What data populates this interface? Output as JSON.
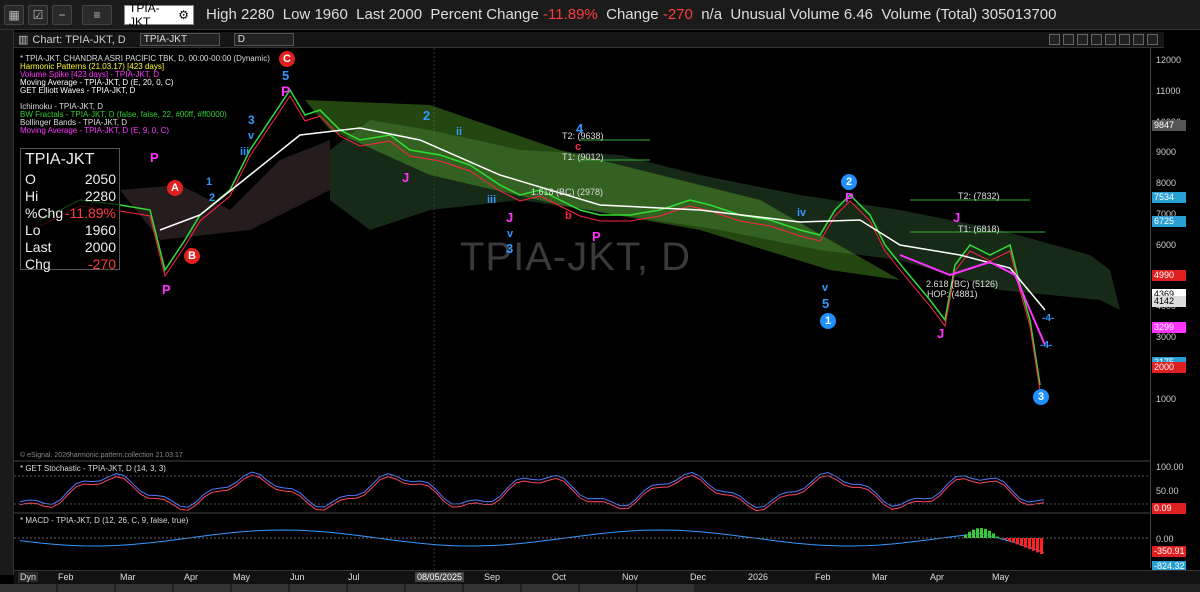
{
  "topbar": {
    "symbol": "TPIA-JKT",
    "high_label": "High",
    "high": "2280",
    "low_label": "Low",
    "low": "1960",
    "last_label": "Last",
    "last": "2000",
    "pct_label": "Percent Change",
    "pct": "-11.89%",
    "chg_label": "Change",
    "chg": "-270",
    "na": "n/a",
    "uv_label": "Unusual Volume",
    "uv": "6.46",
    "vol_label": "Volume (Total)",
    "vol": "305013700"
  },
  "chart_header": {
    "title": "Chart: TPIA-JKT, D",
    "symbol_input": "TPIA-JKT",
    "interval_input": "D"
  },
  "studies": [
    {
      "text": "* TPIA-JKT, CHANDRA ASRI PACIFIC TBK, D, 00:00-00:00 (Dynamic)",
      "color": "#dddddd"
    },
    {
      "text": "Harmonic Patterns (21.03.17) [423 days]",
      "color": "#ffff33"
    },
    {
      "text": "Volume Spike [423 days] - TPIA-JKT, D",
      "color": "#ff33ff"
    },
    {
      "text": "Moving Average - TPIA-JKT, D (E, 20, 0, C)",
      "color": "#ffffff"
    },
    {
      "text": "GET Elliott Waves - TPIA-JKT, D",
      "color": "#ffffff"
    },
    {
      "text": "",
      "color": "#dddddd"
    },
    {
      "text": "Ichimoku - TPIA-JKT, D",
      "color": "#dddddd"
    },
    {
      "text": "BW Fractals - TPIA-JKT, D (false, false, 22, #00ff, #ff0000)",
      "color": "#33cc33"
    },
    {
      "text": "Bollinger Bands - TPIA-JKT, D",
      "color": "#dddddd"
    },
    {
      "text": "Moving Average - TPIA-JKT, D (E, 9, 0, C)",
      "color": "#ff33ff"
    }
  ],
  "watermark": "TPIA-JKT, D",
  "data_box": {
    "title": "TPIA-JKT",
    "rows": [
      {
        "k": "O",
        "v": "2050"
      },
      {
        "k": "Hi",
        "v": "2280"
      },
      {
        "k": "%Chg",
        "v": "-11.89%"
      },
      {
        "k": "Lo",
        "v": "1960"
      },
      {
        "k": "Last",
        "v": "2000"
      },
      {
        "k": "Chg",
        "v": "-270"
      }
    ]
  },
  "price_axis": [
    "12000",
    "11000",
    "10000",
    "9000",
    "8000",
    "7000",
    "6000",
    "5000",
    "4000",
    "3000",
    "2000",
    "1000"
  ],
  "price_badges": [
    {
      "text": "9847",
      "bg": "#555555",
      "fg": "#ffffff"
    },
    {
      "text": "7534",
      "bg": "#2a9fd6",
      "fg": "#ffffff"
    },
    {
      "text": "6725",
      "bg": "#2a9fd6",
      "fg": "#ffffff"
    },
    {
      "text": "4990",
      "bg": "#e02020",
      "fg": "#ffffff"
    },
    {
      "text": "4369",
      "bg": "#ffffff",
      "fg": "#000000"
    },
    {
      "text": "4142",
      "bg": "#dddddd",
      "fg": "#000000"
    },
    {
      "text": "3299",
      "bg": "#ff33ff",
      "fg": "#ffffff"
    },
    {
      "text": "2175",
      "bg": "#2a9fd6",
      "fg": "#ffffff"
    },
    {
      "text": "2000",
      "bg": "#e02020",
      "fg": "#ffffff"
    }
  ],
  "stoch": {
    "title": "* GET Stochastic - TPIA-JKT, D (14, 3, 3)",
    "ticks": [
      "100.00",
      "50.00"
    ],
    "badge": "0.09"
  },
  "macd": {
    "title": "* MACD - TPIA-JKT, D (12, 26, C, 9, false, true)",
    "tick": "0.00",
    "badge1": "-350.91",
    "badge2": "-824.32"
  },
  "copyright": "© eSignal. 2026harmonic.pattern.collection 21.03.17",
  "x_axis": [
    "Feb",
    "Mar",
    "Apr",
    "May",
    "Jun",
    "Jul",
    "08/05/2025",
    "Sep",
    "Oct",
    "Nov",
    "Dec",
    "2026",
    "Feb",
    "Mar",
    "Apr",
    "May"
  ],
  "dyn_label": "Dyn",
  "annotations": {
    "t2a": "T2: (9638)",
    "t1a": "T1: (9012)",
    "fib1": "1.618 (BC) (2978)",
    "t2b": "T2: (7832)",
    "t1b": "T1: (6818)",
    "fib2": "2.618 (BC) (5126)",
    "hop": "HOP: (4881)",
    "red_A": "A",
    "red_B": "B",
    "red_C": "C",
    "blue_1": "1",
    "blue_2": "2",
    "blue_3": "3",
    "w5": "5",
    "w4": "4",
    "w3": "3",
    "w2": "2",
    "wv": "v",
    "wiii": "iii",
    "wi": "i",
    "wii": "ii",
    "wiv": "iv",
    "P": "P",
    "J": "J",
    "b": "b",
    "c": "c",
    "m4": "-4-"
  },
  "colors": {
    "up": "#33dd33",
    "down": "#ff2244",
    "ma20": "#ffffff",
    "ma9": "#ff33ff",
    "wave": "#3399ff",
    "pattern": "#aa44ff"
  }
}
